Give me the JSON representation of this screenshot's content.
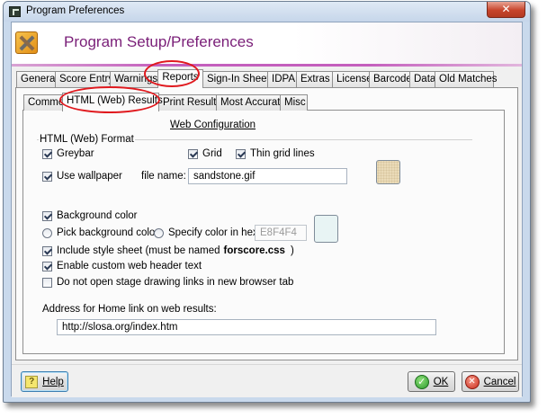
{
  "window": {
    "title": "Program Preferences",
    "close_glyph": "✕"
  },
  "header": {
    "title": "Program Setup/Preferences",
    "icon": "tools-icon"
  },
  "main_tabs": [
    "General",
    "Score Entry",
    "Warnings",
    "Reports",
    "Sign-In Sheets",
    "IDPA",
    "Extras",
    "License",
    "Barcode",
    "Data",
    "Old Matches"
  ],
  "main_tabs_active": "Reports",
  "sub_tabs": [
    "Common",
    "HTML (Web) Results",
    "Print Results",
    "Most Accurate",
    "Misc"
  ],
  "sub_tabs_active": "HTML (Web) Results",
  "web_config": {
    "heading": "Web Configuration",
    "group_label": "HTML (Web) Format",
    "greybar": {
      "label": "Greybar",
      "checked": true
    },
    "grid": {
      "label": "Grid",
      "checked": true
    },
    "thin_grid": {
      "label": "Thin grid lines",
      "checked": true
    },
    "use_wallpaper": {
      "label": "Use wallpaper",
      "checked": true
    },
    "file_name_label": "file name:",
    "file_name_value": "sandstone.gif",
    "background_color": {
      "label": "Background color",
      "checked": true
    },
    "pick_background": {
      "label": "Pick background color",
      "selected": false
    },
    "specify_hex": {
      "label": "Specify color in hex",
      "selected": false
    },
    "hex_value": "E8F4F4",
    "hex_swatch_color": "#E8F4F4",
    "include_style": {
      "label": "Include style sheet (must be named",
      "file": "forscore.css",
      "suffix": ")",
      "checked": true
    },
    "custom_header": {
      "label": "Enable custom web header text",
      "checked": true
    },
    "no_new_tab": {
      "label": "Do not open stage drawing links in new browser tab",
      "checked": false
    },
    "home_link_label": "Address for Home link on web results:",
    "home_link_value": "http://slosa.org/index.htm"
  },
  "buttons": {
    "help_label": "Help",
    "ok_label": "OK",
    "cancel_label": "Cancel",
    "help_glyph": "?",
    "ok_glyph": "✓",
    "cancel_glyph": "✕"
  },
  "colors": {
    "accent": "#7A1F78",
    "annotation": "#E0191E"
  }
}
